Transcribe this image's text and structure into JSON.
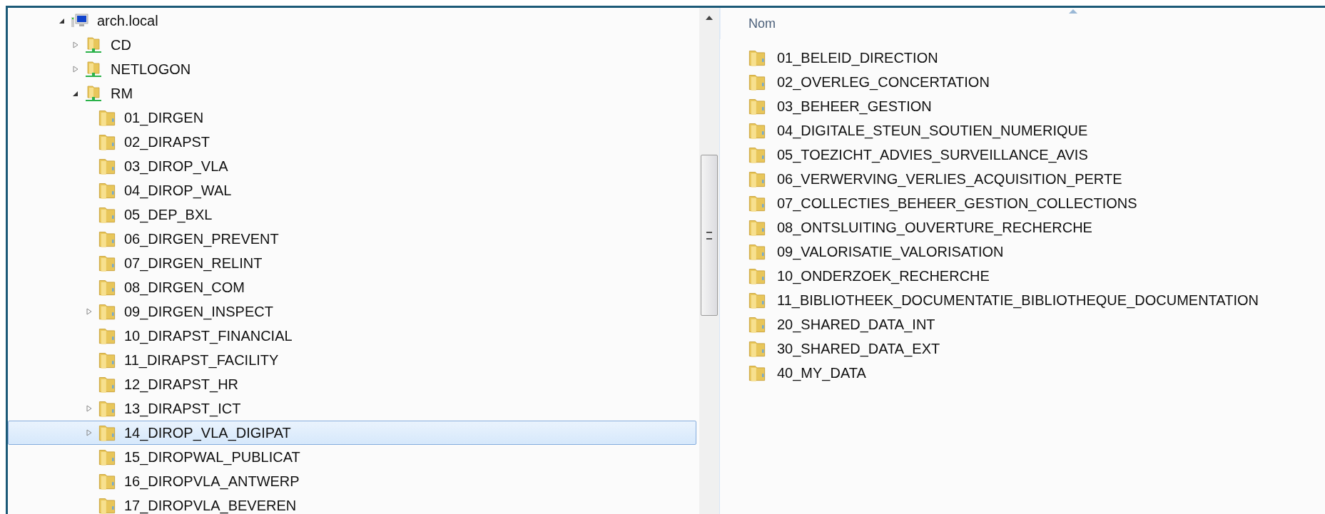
{
  "tree": [
    {
      "label": "arch.local",
      "kind": "computer",
      "expanded": true,
      "selected": false,
      "children": [
        {
          "label": "CD",
          "kind": "share",
          "expanded": false,
          "selected": false
        },
        {
          "label": "NETLOGON",
          "kind": "share",
          "expanded": false,
          "selected": false
        },
        {
          "label": "RM",
          "kind": "share",
          "expanded": true,
          "selected": false,
          "children": [
            {
              "label": "01_DIRGEN",
              "kind": "folder",
              "selected": false
            },
            {
              "label": "02_DIRAPST",
              "kind": "folder",
              "selected": false
            },
            {
              "label": "03_DIROP_VLA",
              "kind": "folder",
              "selected": false
            },
            {
              "label": "04_DIROP_WAL",
              "kind": "folder",
              "selected": false
            },
            {
              "label": "05_DEP_BXL",
              "kind": "folder",
              "selected": false
            },
            {
              "label": "06_DIRGEN_PREVENT",
              "kind": "folder",
              "selected": false
            },
            {
              "label": "07_DIRGEN_RELINT",
              "kind": "folder",
              "selected": false
            },
            {
              "label": "08_DIRGEN_COM",
              "kind": "folder",
              "selected": false
            },
            {
              "label": "09_DIRGEN_INSPECT",
              "kind": "folder",
              "expanded": false,
              "selected": false
            },
            {
              "label": "10_DIRAPST_FINANCIAL",
              "kind": "folder",
              "selected": false
            },
            {
              "label": "11_DIRAPST_FACILITY",
              "kind": "folder",
              "selected": false
            },
            {
              "label": "12_DIRAPST_HR",
              "kind": "folder",
              "selected": false
            },
            {
              "label": "13_DIRAPST_ICT",
              "kind": "folder",
              "expanded": false,
              "selected": false
            },
            {
              "label": "14_DIROP_VLA_DIGIPAT",
              "kind": "folder",
              "expanded": false,
              "selected": true
            },
            {
              "label": "15_DIROPWAL_PUBLICAT",
              "kind": "folder",
              "selected": false
            },
            {
              "label": "16_DIROPVLA_ANTWERP",
              "kind": "folder",
              "selected": false
            },
            {
              "label": "17_DIROPVLA_BEVEREN",
              "kind": "folder",
              "selected": false
            }
          ]
        }
      ]
    }
  ],
  "file_list": {
    "columns": [
      "Nom"
    ],
    "items": [
      "01_BELEID_DIRECTION",
      "02_OVERLEG_CONCERTATION",
      "03_BEHEER_GESTION",
      "04_DIGITALE_STEUN_SOUTIEN_NUMERIQUE",
      "05_TOEZICHT_ADVIES_SURVEILLANCE_AVIS",
      "06_VERWERVING_VERLIES_ACQUISITION_PERTE",
      "07_COLLECTIES_BEHEER_GESTION_COLLECTIONS",
      "08_ONTSLUITING_OUVERTURE_RECHERCHE",
      "09_VALORISATIE_VALORISATION",
      "10_ONDERZOEK_RECHERCHE",
      "11_BIBLIOTHEEK_DOCUMENTATIE_BIBLIOTHEQUE_DOCUMENTATION",
      "20_SHARED_DATA_INT",
      "30_SHARED_DATA_EXT",
      "40_MY_DATA"
    ]
  }
}
